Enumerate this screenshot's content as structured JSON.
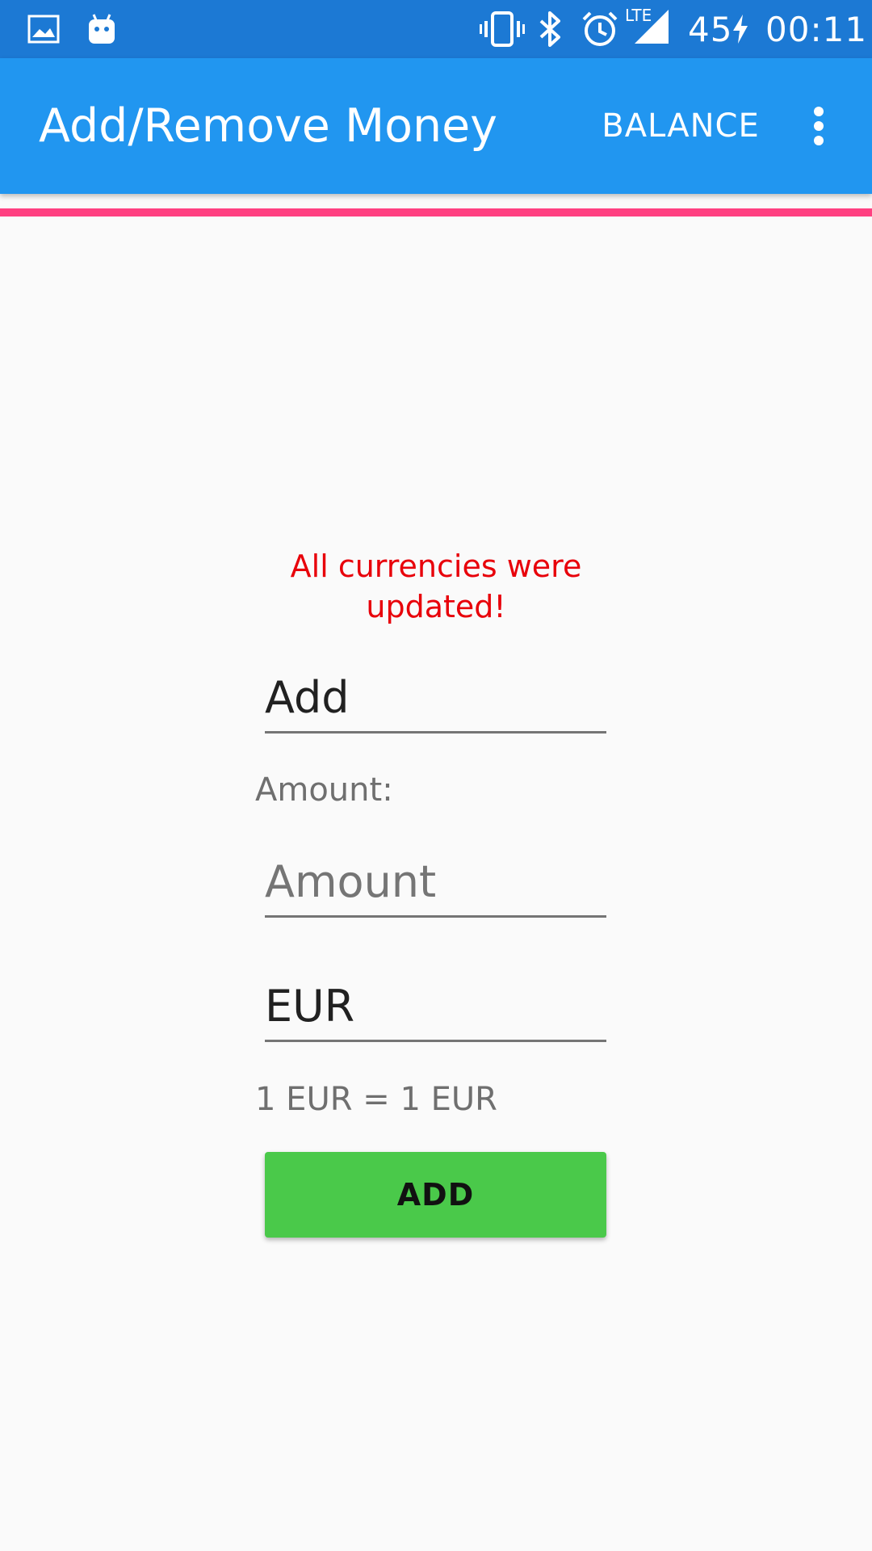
{
  "status_bar": {
    "icons": [
      "image-icon",
      "android-icon",
      "vibrate-icon",
      "bluetooth-icon",
      "alarm-icon",
      "lte-signal-icon",
      "charging-icon"
    ],
    "lte_label": "LTE",
    "battery": "45",
    "time": "00:11"
  },
  "app_bar": {
    "title": "Add/Remove Money",
    "balance_label": "BALANCE",
    "overflow_icon": "more-vert-icon",
    "background_color": "#2196f0"
  },
  "accent_color": "#ff4081",
  "status_message": "All currencies were updated!",
  "form": {
    "operation_value": "Add",
    "amount_label": "Amount:",
    "amount_placeholder": "Amount",
    "currency_value": "EUR",
    "rate_text": "1 EUR = 1 EUR",
    "submit_label": "ADD",
    "submit_color": "#4ac94a"
  }
}
